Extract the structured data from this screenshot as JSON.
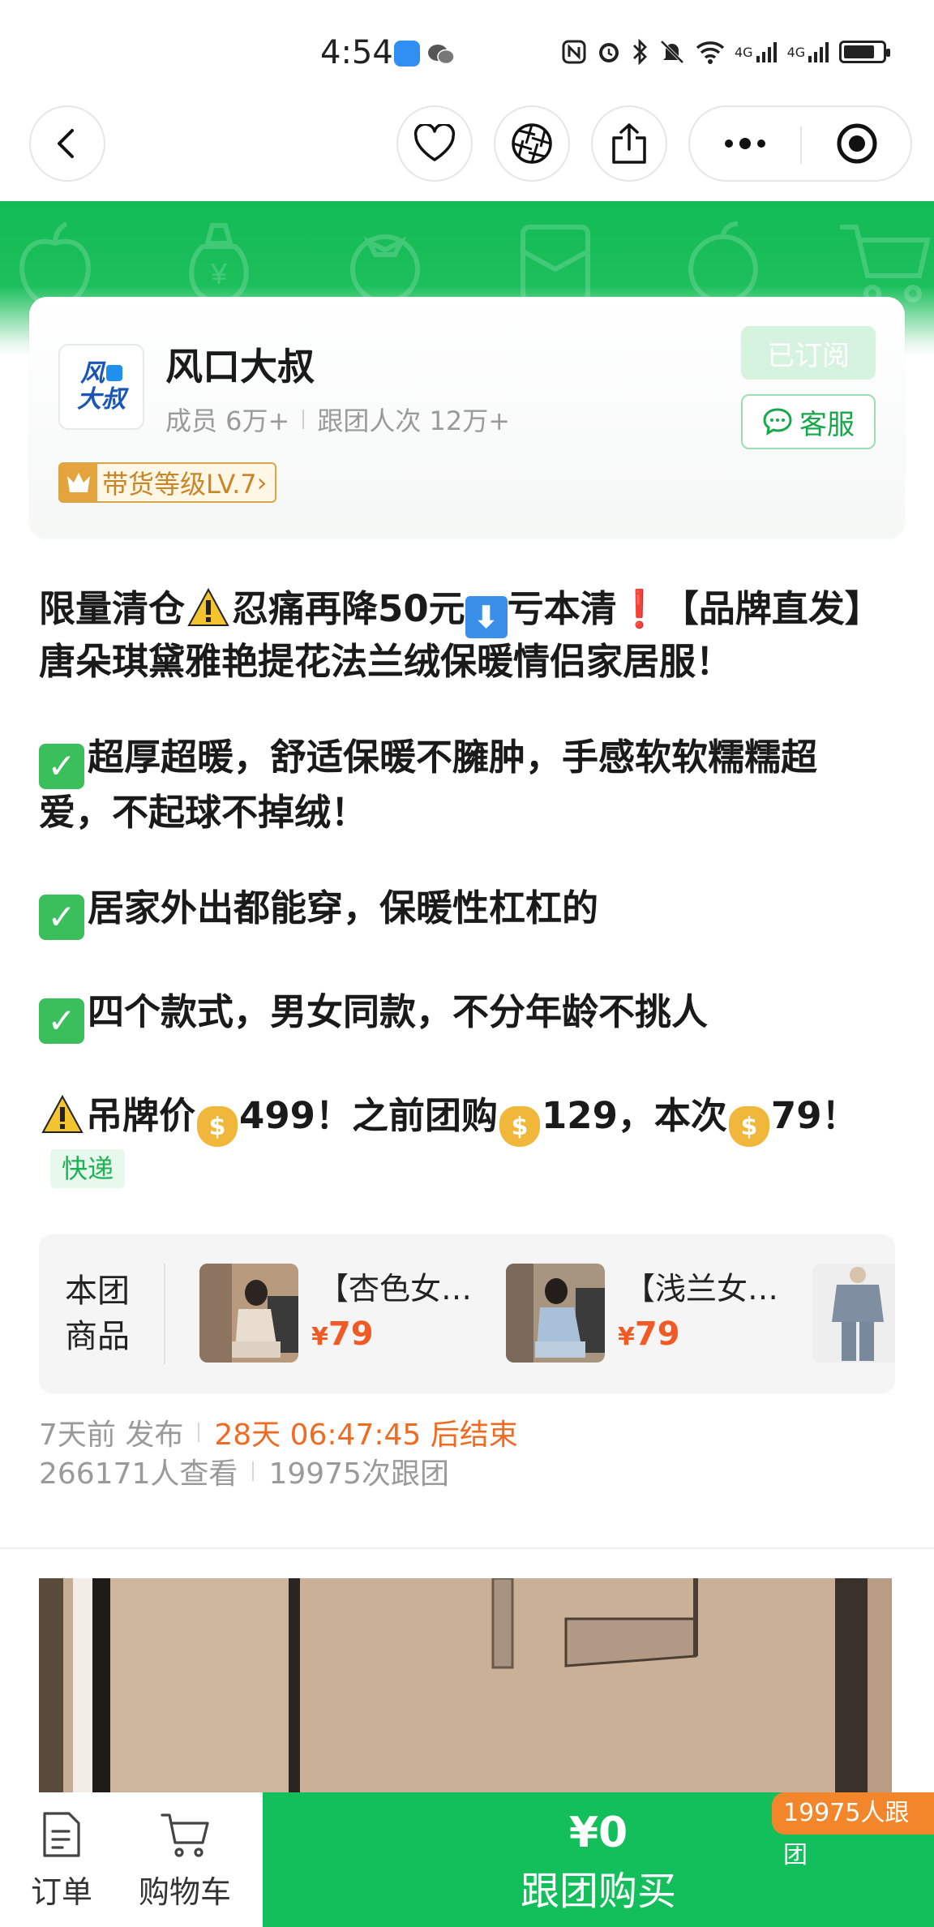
{
  "status_bar": {
    "time": "4:54",
    "net_label_1": "4G",
    "net_label_2": "4G"
  },
  "nav": {
    "back": "back",
    "favorite": "favorite",
    "share_circle": "shutter",
    "share": "share",
    "more": "more",
    "close": "close"
  },
  "group": {
    "name": "风口大叔",
    "logo_line1": "风",
    "logo_line2": "大叔",
    "members": "成员 6万+",
    "followers": "跟团人次 12万+",
    "subscribed": "已订阅",
    "service": "客服",
    "level": "带货等级LV.7",
    "level_arrow": "›"
  },
  "description": {
    "line1_a": "限量清仓",
    "line1_b": "忍痛再降50元",
    "line1_c": "亏本清",
    "line1_excl": "❗",
    "line1_d": "【品牌直发】唐朵琪黛雅艳提花法兰绒保暖情侣家居服！",
    "line2": "超厚超暖，舒适保暖不臃肿，手感软软糯糯超爱，不起球不掉绒！",
    "line3": "居家外出都能穿，保暖性杠杠的",
    "line4": "四个款式，男女同款，不分年龄不挑人",
    "line5_a": "吊牌价",
    "line5_b": "499！之前团购",
    "line5_c": "129，本次",
    "line5_d": "79！",
    "express": "快递"
  },
  "products": {
    "label": "本团商品",
    "items": [
      {
        "name": "【杏色女…",
        "price": "79",
        "currency": "¥"
      },
      {
        "name": "【浅兰女…",
        "price": "79",
        "currency": "¥"
      }
    ]
  },
  "meta": {
    "published": "7天前 发布",
    "ends": "28天 06:47:45 后结束",
    "views": "266171人查看",
    "follows": "19975次跟团"
  },
  "bottom": {
    "orders": "订单",
    "cart": "购物车",
    "price": "¥0",
    "buy": "跟团购买",
    "badge": "19975人跟团"
  },
  "colors": {
    "brand_green": "#12bf5a",
    "countdown_orange": "#f06a22",
    "price_orange": "#f15a24"
  }
}
